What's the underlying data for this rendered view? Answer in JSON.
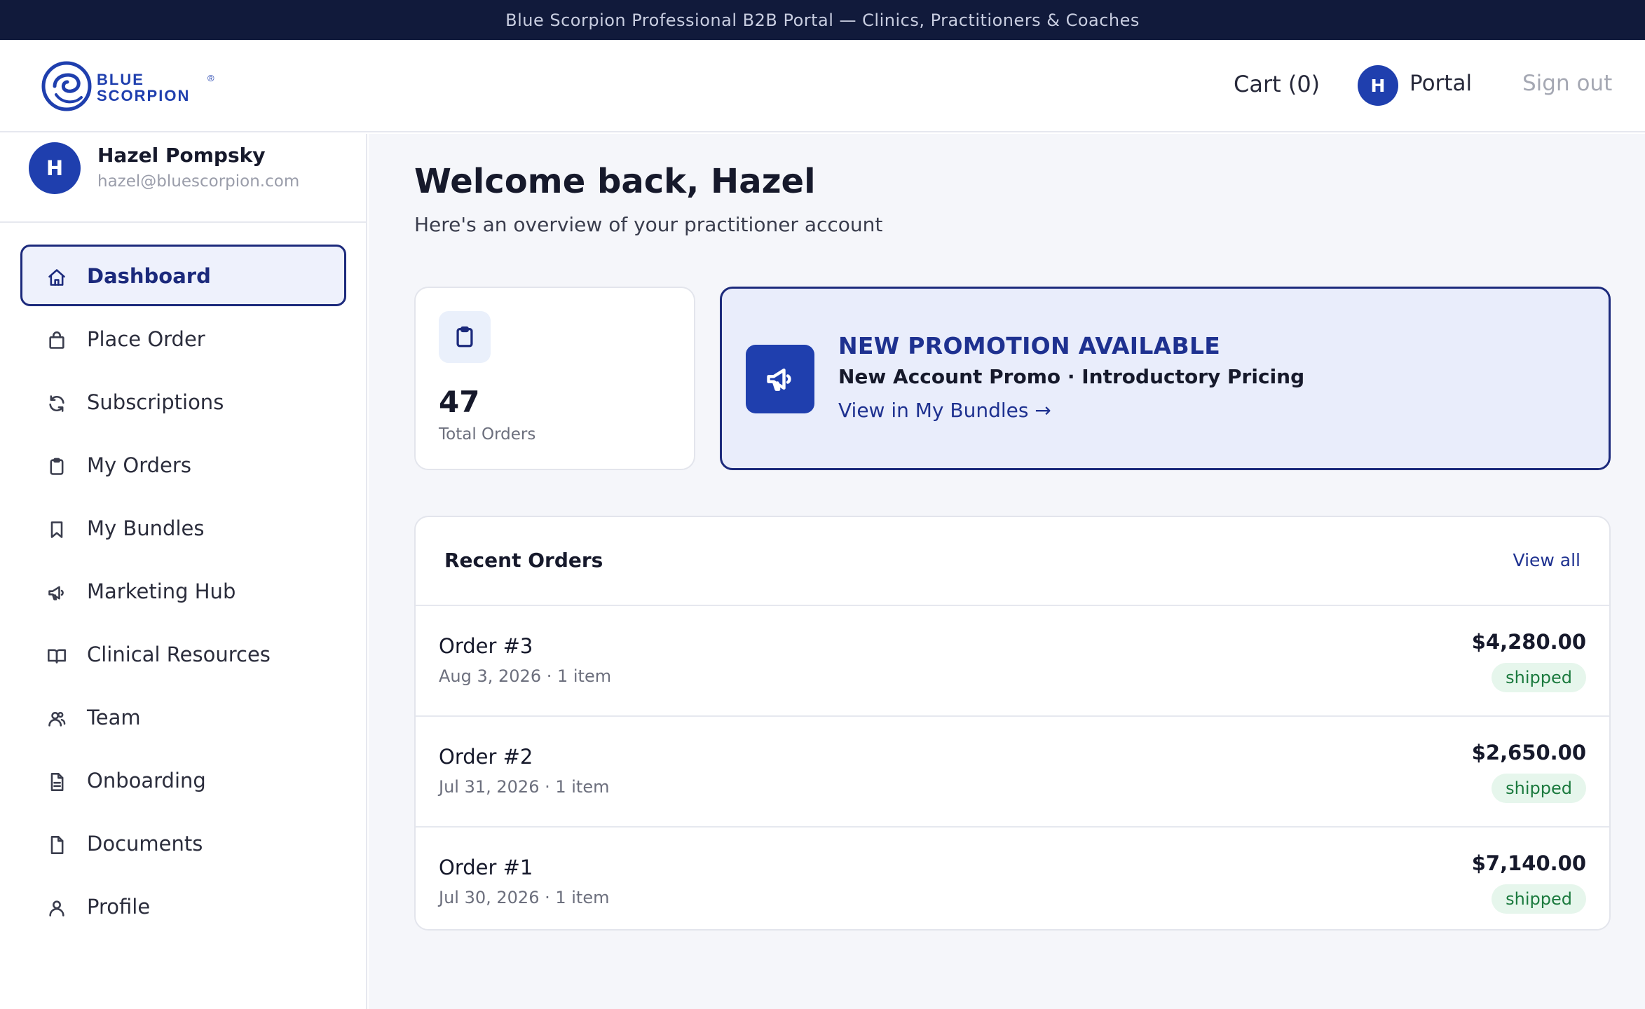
{
  "banner": {
    "text": "Blue Scorpion Professional B2B Portal — Clinics, Practitioners & Coaches"
  },
  "header": {
    "logo_line1": "BLUE",
    "logo_line2": "SCORPION",
    "logo_mark": "®",
    "cart_label": "Cart (0)",
    "avatar_initial": "H",
    "portal_label": "Portal",
    "signout_label": "Sign out"
  },
  "user": {
    "initial": "H",
    "name": "Hazel Pompsky",
    "email": "hazel@bluescorpion.com"
  },
  "sidebar": {
    "items": [
      {
        "label": "Dashboard",
        "icon": "home-icon",
        "active": true
      },
      {
        "label": "Place Order",
        "icon": "shopping-bag-icon",
        "active": false
      },
      {
        "label": "Subscriptions",
        "icon": "refresh-icon",
        "active": false
      },
      {
        "label": "My Orders",
        "icon": "clipboard-icon",
        "active": false
      },
      {
        "label": "My Bundles",
        "icon": "bookmark-icon",
        "active": false
      },
      {
        "label": "Marketing Hub",
        "icon": "megaphone-icon",
        "active": false
      },
      {
        "label": "Clinical Resources",
        "icon": "book-open-icon",
        "active": false
      },
      {
        "label": "Team",
        "icon": "team-icon",
        "active": false
      },
      {
        "label": "Onboarding",
        "icon": "document-text-icon",
        "active": false
      },
      {
        "label": "Documents",
        "icon": "file-icon",
        "active": false
      },
      {
        "label": "Profile",
        "icon": "user-icon",
        "active": false
      }
    ]
  },
  "main": {
    "welcome": "Welcome back, Hazel",
    "subtitle": "Here's an overview of your practitioner account",
    "orders_card": {
      "count": "47",
      "label": "Total Orders",
      "icon": "clipboard-icon"
    },
    "promo": {
      "icon": "megaphone-icon",
      "title": "NEW PROMOTION AVAILABLE",
      "description": "New Account Promo · Introductory Pricing",
      "link": "View in My Bundles →"
    },
    "recent": {
      "title": "Recent Orders",
      "view_all": "View all",
      "orders": [
        {
          "title": "Order #3",
          "meta": "Aug 3, 2026 · 1 item",
          "amount": "$4,280.00",
          "status": "shipped"
        },
        {
          "title": "Order #2",
          "meta": "Jul 31, 2026 · 1 item",
          "amount": "$2,650.00",
          "status": "shipped"
        },
        {
          "title": "Order #1",
          "meta": "Jul 30, 2026 · 1 item",
          "amount": "$7,140.00",
          "status": "shipped"
        }
      ]
    }
  },
  "colors": {
    "banner_bg": "#111a3b",
    "brand_blue": "#1f3fae",
    "nav_active": "#1c2a7c",
    "status_green": "#1b7a3e"
  }
}
